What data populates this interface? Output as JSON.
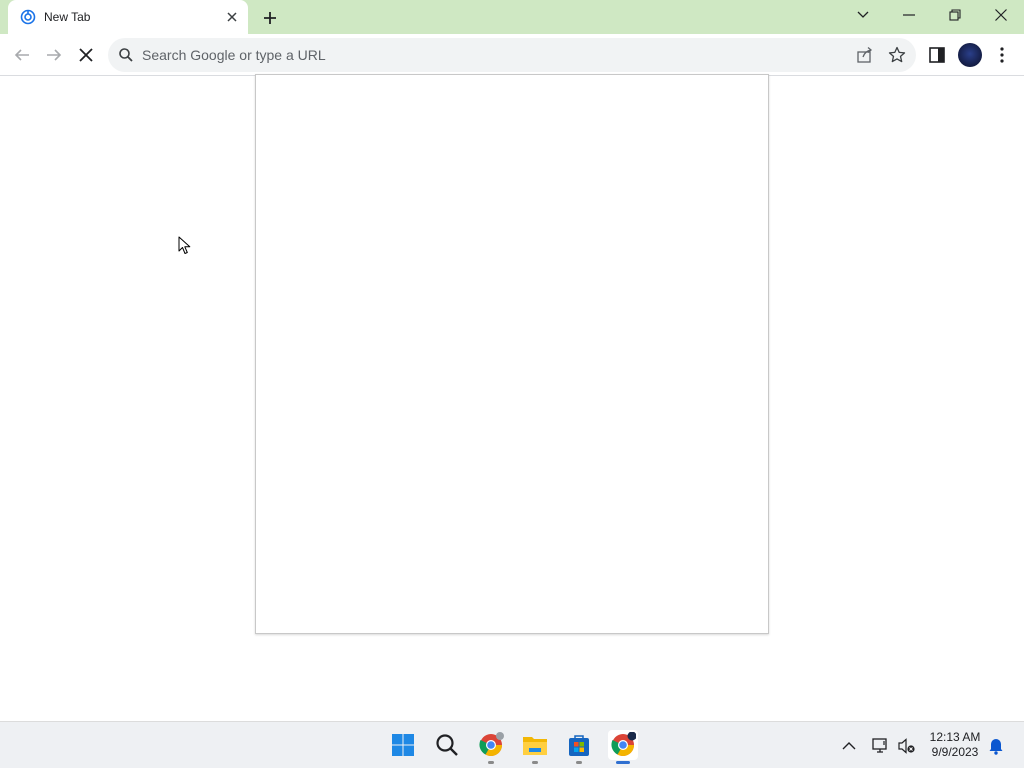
{
  "browser": {
    "tab": {
      "title": "New Tab"
    },
    "omnibox": {
      "placeholder": "Search Google or type a URL"
    }
  },
  "taskbar": {
    "apps": [
      "windows-start",
      "search",
      "chrome-profile",
      "file-explorer",
      "microsoft-store",
      "chrome"
    ],
    "clock": {
      "time": "12:13 AM",
      "date": "9/9/2023"
    }
  },
  "colors": {
    "titlebar": "#cfe8c3",
    "omnibox_bg": "#f1f3f4",
    "taskbar_bg": "#eef0f3",
    "accent": "#2f6fd0"
  }
}
